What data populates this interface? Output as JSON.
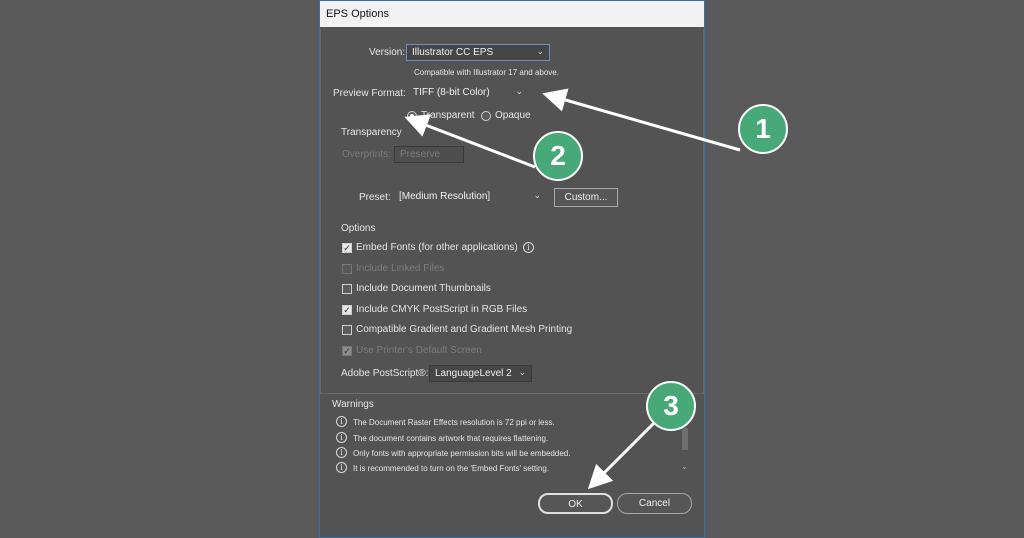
{
  "dialog": {
    "title": "EPS Options",
    "version": {
      "label": "Version:",
      "value": "Illustrator CC EPS",
      "note": "Compatible with Illustrator 17 and above."
    },
    "preview": {
      "label": "Preview Format:",
      "value": "TIFF (8-bit Color)",
      "radio_transparent": "Transparent",
      "radio_opaque": "Opaque",
      "selected": "Transparent"
    },
    "transparency": {
      "heading": "Transparency",
      "overprints_label": "Overprints:",
      "overprints_value": "Preserve",
      "preset_label": "Preset:",
      "preset_value": "[Medium Resolution]",
      "custom_button": "Custom..."
    },
    "options": {
      "heading": "Options",
      "items": [
        {
          "label": "Embed Fonts (for other applications)",
          "checked": true,
          "enabled": true
        },
        {
          "label": "Include Linked Files",
          "checked": false,
          "enabled": false
        },
        {
          "label": "Include Document Thumbnails",
          "checked": false,
          "enabled": true
        },
        {
          "label": "Include CMYK PostScript in RGB Files",
          "checked": true,
          "enabled": true
        },
        {
          "label": "Compatible Gradient and Gradient Mesh Printing",
          "checked": false,
          "enabled": true
        },
        {
          "label": "Use Printer's Default Screen",
          "checked": true,
          "enabled": false
        }
      ],
      "postscript_label": "Adobe PostScript®:",
      "postscript_value": "LanguageLevel 2"
    },
    "warnings": {
      "heading": "Warnings",
      "items": [
        "The Document Raster Effects resolution is 72 ppi or less.",
        "The document contains artwork that requires flattening.",
        "Only fonts with appropriate permission bits will be embedded.",
        "It is recommended to turn on the 'Embed Fonts' setting."
      ]
    },
    "buttons": {
      "ok": "OK",
      "cancel": "Cancel"
    }
  },
  "annotations": {
    "badge_1": "1",
    "badge_2": "2",
    "badge_3": "3",
    "badge_color": "#47a878",
    "arrow_color": "#ffffff"
  }
}
